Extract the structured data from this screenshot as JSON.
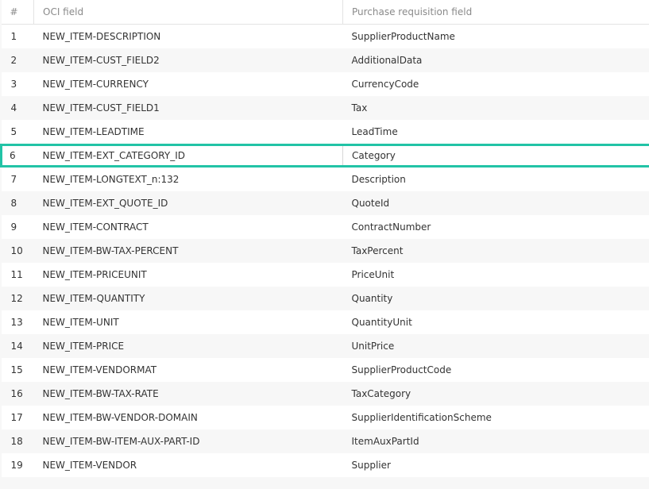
{
  "table": {
    "headers": {
      "num": "#",
      "oci": "OCI field",
      "pr": "Purchase requisition field"
    },
    "selected_row": 6,
    "rows": [
      {
        "num": "1",
        "oci": "NEW_ITEM-DESCRIPTION",
        "pr": "SupplierProductName"
      },
      {
        "num": "2",
        "oci": "NEW_ITEM-CUST_FIELD2",
        "pr": "AdditionalData"
      },
      {
        "num": "3",
        "oci": "NEW_ITEM-CURRENCY",
        "pr": "CurrencyCode"
      },
      {
        "num": "4",
        "oci": "NEW_ITEM-CUST_FIELD1",
        "pr": "Tax"
      },
      {
        "num": "5",
        "oci": "NEW_ITEM-LEADTIME",
        "pr": "LeadTime"
      },
      {
        "num": "6",
        "oci": "NEW_ITEM-EXT_CATEGORY_ID",
        "pr": "Category"
      },
      {
        "num": "7",
        "oci": "NEW_ITEM-LONGTEXT_n:132",
        "pr": "Description"
      },
      {
        "num": "8",
        "oci": "NEW_ITEM-EXT_QUOTE_ID",
        "pr": "QuoteId"
      },
      {
        "num": "9",
        "oci": "NEW_ITEM-CONTRACT",
        "pr": "ContractNumber"
      },
      {
        "num": "10",
        "oci": "NEW_ITEM-BW-TAX-PERCENT",
        "pr": "TaxPercent"
      },
      {
        "num": "11",
        "oci": "NEW_ITEM-PRICEUNIT",
        "pr": "PriceUnit"
      },
      {
        "num": "12",
        "oci": "NEW_ITEM-QUANTITY",
        "pr": "Quantity"
      },
      {
        "num": "13",
        "oci": "NEW_ITEM-UNIT",
        "pr": "QuantityUnit"
      },
      {
        "num": "14",
        "oci": "NEW_ITEM-PRICE",
        "pr": "UnitPrice"
      },
      {
        "num": "15",
        "oci": "NEW_ITEM-VENDORMAT",
        "pr": "SupplierProductCode"
      },
      {
        "num": "16",
        "oci": "NEW_ITEM-BW-TAX-RATE",
        "pr": "TaxCategory"
      },
      {
        "num": "17",
        "oci": "NEW_ITEM-BW-VENDOR-DOMAIN",
        "pr": "SupplierIdentificationScheme"
      },
      {
        "num": "18",
        "oci": "NEW_ITEM-BW-ITEM-AUX-PART-ID",
        "pr": "ItemAuxPartId"
      },
      {
        "num": "19",
        "oci": "NEW_ITEM-VENDOR",
        "pr": "Supplier"
      }
    ]
  },
  "colors": {
    "selection_border": "#22c3a6",
    "header_text": "#8a8a8a",
    "row_alt_background": "#f7f7f7"
  }
}
